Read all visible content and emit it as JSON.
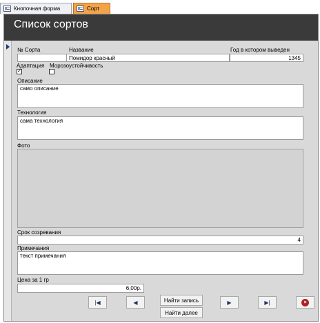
{
  "tabs": [
    {
      "label": "Кнопочная форма",
      "icon": "form-icon"
    },
    {
      "label": "Сорт",
      "icon": "form-icon",
      "active": true
    }
  ],
  "form": {
    "title": "Список сортов",
    "fields": {
      "sort_number": {
        "label": "№ Сорта",
        "value": ""
      },
      "name": {
        "label": "Название",
        "value": "Помидор красный"
      },
      "year": {
        "label": "Год в котором выведен",
        "value": "1345"
      },
      "adaptation": {
        "label": "Адаптация",
        "checked": true
      },
      "frost": {
        "label": "Морозоустойчивость",
        "checked": false
      },
      "description": {
        "label": "Описание",
        "value": "само описание"
      },
      "technology": {
        "label": "Технология",
        "value": "сама технология"
      },
      "photo": {
        "label": "Фото"
      },
      "ripening": {
        "label": "Срок созревания",
        "value": "4"
      },
      "notes": {
        "label": "Примечания",
        "value": "текст примечания"
      },
      "price": {
        "label": "Цена за 1 гр",
        "value": "6,00р."
      }
    },
    "buttons": {
      "find_record": "Найти запись",
      "find_next": "Найти далее"
    }
  },
  "colors": {
    "header_bg": "#3a3a3a",
    "form_bg": "#d9d9d9",
    "active_tab": "#f3a44a",
    "close_button": "#b02020"
  }
}
